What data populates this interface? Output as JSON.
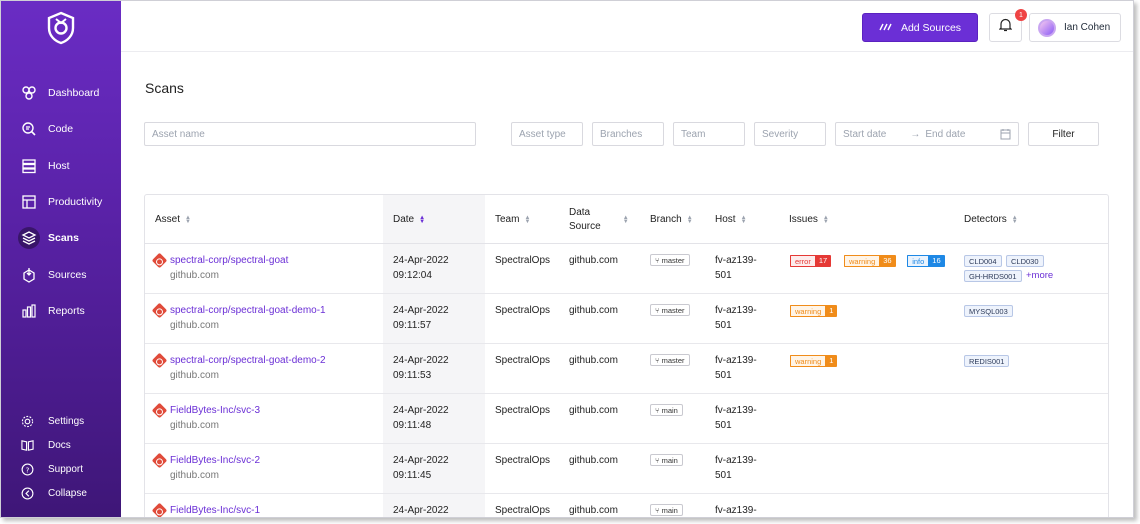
{
  "sidebar": {
    "items": [
      {
        "label": "Dashboard",
        "icon": "dashboard-icon"
      },
      {
        "label": "Code",
        "icon": "code-icon"
      },
      {
        "label": "Host",
        "icon": "host-icon"
      },
      {
        "label": "Productivity",
        "icon": "productivity-icon"
      },
      {
        "label": "Scans",
        "icon": "scans-icon",
        "active": true
      },
      {
        "label": "Sources",
        "icon": "sources-icon"
      },
      {
        "label": "Reports",
        "icon": "reports-icon"
      }
    ],
    "bottom": [
      {
        "label": "Settings",
        "icon": "gear-icon"
      },
      {
        "label": "Docs",
        "icon": "book-icon"
      },
      {
        "label": "Support",
        "icon": "help-icon"
      },
      {
        "label": "Collapse",
        "icon": "collapse-icon"
      }
    ]
  },
  "topbar": {
    "add_sources_label": "Add Sources",
    "notification_count": "1",
    "user_name": "Ian Cohen"
  },
  "page": {
    "title": "Scans"
  },
  "filters": {
    "asset_name": "Asset name",
    "asset_type": "Asset type",
    "branches": "Branches",
    "team": "Team",
    "severity": "Severity",
    "start_date": "Start date",
    "end_date": "End date",
    "filter_label": "Filter"
  },
  "table": {
    "headers": {
      "asset": "Asset",
      "date": "Date",
      "team": "Team",
      "data_source_1": "Data",
      "data_source_2": "Source",
      "branch": "Branch",
      "host": "Host",
      "issues": "Issues",
      "detectors": "Detectors"
    },
    "rows": [
      {
        "asset": "spectral-corp/spectral-goat",
        "source": "github.com",
        "date": "24-Apr-2022",
        "time": "09:12:04",
        "team": "SpectralOps",
        "data_source": "github.com",
        "branch": "master",
        "host1": "fv-az139-",
        "host2": "501",
        "issues": [
          {
            "label": "error",
            "count": "17"
          },
          {
            "label": "warning",
            "count": "36"
          },
          {
            "label": "info",
            "count": "16"
          }
        ],
        "detectors": [
          "CLD004",
          "CLD030",
          "GH-HRDS001"
        ],
        "more": "+more"
      },
      {
        "asset": "spectral-corp/spectral-goat-demo-1",
        "source": "github.com",
        "date": "24-Apr-2022",
        "time": "09:11:57",
        "team": "SpectralOps",
        "data_source": "github.com",
        "branch": "master",
        "host1": "fv-az139-",
        "host2": "501",
        "issues": [
          {
            "label": "warning",
            "count": "1"
          }
        ],
        "detectors": [
          "MYSQL003"
        ]
      },
      {
        "asset": "spectral-corp/spectral-goat-demo-2",
        "source": "github.com",
        "date": "24-Apr-2022",
        "time": "09:11:53",
        "team": "SpectralOps",
        "data_source": "github.com",
        "branch": "master",
        "host1": "fv-az139-",
        "host2": "501",
        "issues": [
          {
            "label": "warning",
            "count": "1"
          }
        ],
        "detectors": [
          "REDIS001"
        ]
      },
      {
        "asset": "FieldBytes-Inc/svc-3",
        "source": "github.com",
        "date": "24-Apr-2022",
        "time": "09:11:48",
        "team": "SpectralOps",
        "data_source": "github.com",
        "branch": "main",
        "host1": "fv-az139-",
        "host2": "501",
        "issues": [],
        "detectors": []
      },
      {
        "asset": "FieldBytes-Inc/svc-2",
        "source": "github.com",
        "date": "24-Apr-2022",
        "time": "09:11:45",
        "team": "SpectralOps",
        "data_source": "github.com",
        "branch": "main",
        "host1": "fv-az139-",
        "host2": "501",
        "issues": [],
        "detectors": []
      },
      {
        "asset": "FieldBytes-Inc/svc-1",
        "source": "",
        "date": "24-Apr-2022",
        "time": "",
        "team": "SpectralOps",
        "data_source": "github.com",
        "branch": "main",
        "host1": "fv-az139-",
        "host2": "",
        "issues": [],
        "detectors": []
      }
    ]
  },
  "colors": {
    "brand": "#6b2fd6",
    "error": "#e53935",
    "warning": "#f08c1a",
    "info": "#1e88e5"
  }
}
